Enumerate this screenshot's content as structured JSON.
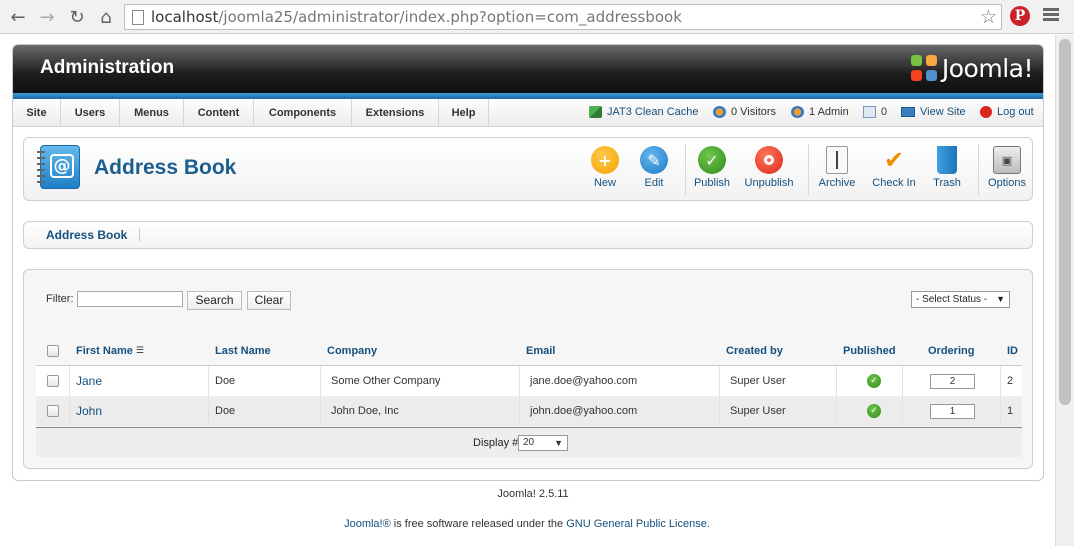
{
  "browser": {
    "url_host": "localhost",
    "url_path": "/joomla25/administrator/index.php?option=com_addressbook"
  },
  "header": {
    "title": "Administration",
    "logo_text": "Joomla!"
  },
  "menu": {
    "items": [
      "Site",
      "Users",
      "Menus",
      "Content",
      "Components",
      "Extensions",
      "Help"
    ],
    "status": {
      "cache": "JAT3 Clean Cache",
      "visitors": "0 Visitors",
      "admins": "1 Admin",
      "messages": "0",
      "view_site": "View Site",
      "logout": "Log out"
    }
  },
  "toolbar": {
    "title": "Address Book",
    "buttons": {
      "new": "New",
      "edit": "Edit",
      "publish": "Publish",
      "unpublish": "Unpublish",
      "archive": "Archive",
      "checkin": "Check In",
      "trash": "Trash",
      "options": "Options"
    },
    "colors": {
      "new": "#f5a300",
      "edit": "#2e8ed6",
      "publish": "#3a9a1e",
      "unpublish": "#e2361c"
    }
  },
  "submenu": {
    "item": "Address Book"
  },
  "filter": {
    "label": "Filter:",
    "value": "",
    "search_label": "Search",
    "clear_label": "Clear",
    "status_select": "- Select Status -"
  },
  "table": {
    "columns": {
      "first_name": "First Name",
      "last_name": "Last Name",
      "company": "Company",
      "email": "Email",
      "created_by": "Created by",
      "published": "Published",
      "ordering": "Ordering",
      "id": "ID"
    },
    "rows": [
      {
        "first_name": "Jane",
        "last_name": "Doe",
        "company": "Some Other Company",
        "email": "jane.doe@yahoo.com",
        "created_by": "Super User",
        "ordering": "2",
        "id": "2"
      },
      {
        "first_name": "John",
        "last_name": "Doe",
        "company": "John Doe, Inc",
        "email": "john.doe@yahoo.com",
        "created_by": "Super User",
        "ordering": "1",
        "id": "1"
      }
    ],
    "display_label": "Display #",
    "display_limit": "20"
  },
  "footer": {
    "version": "Joomla! 2.5.11",
    "license_link1": "Joomla!®",
    "license_mid": " is free software released under the ",
    "license_link2": "GNU General Public License",
    "license_end": "."
  }
}
